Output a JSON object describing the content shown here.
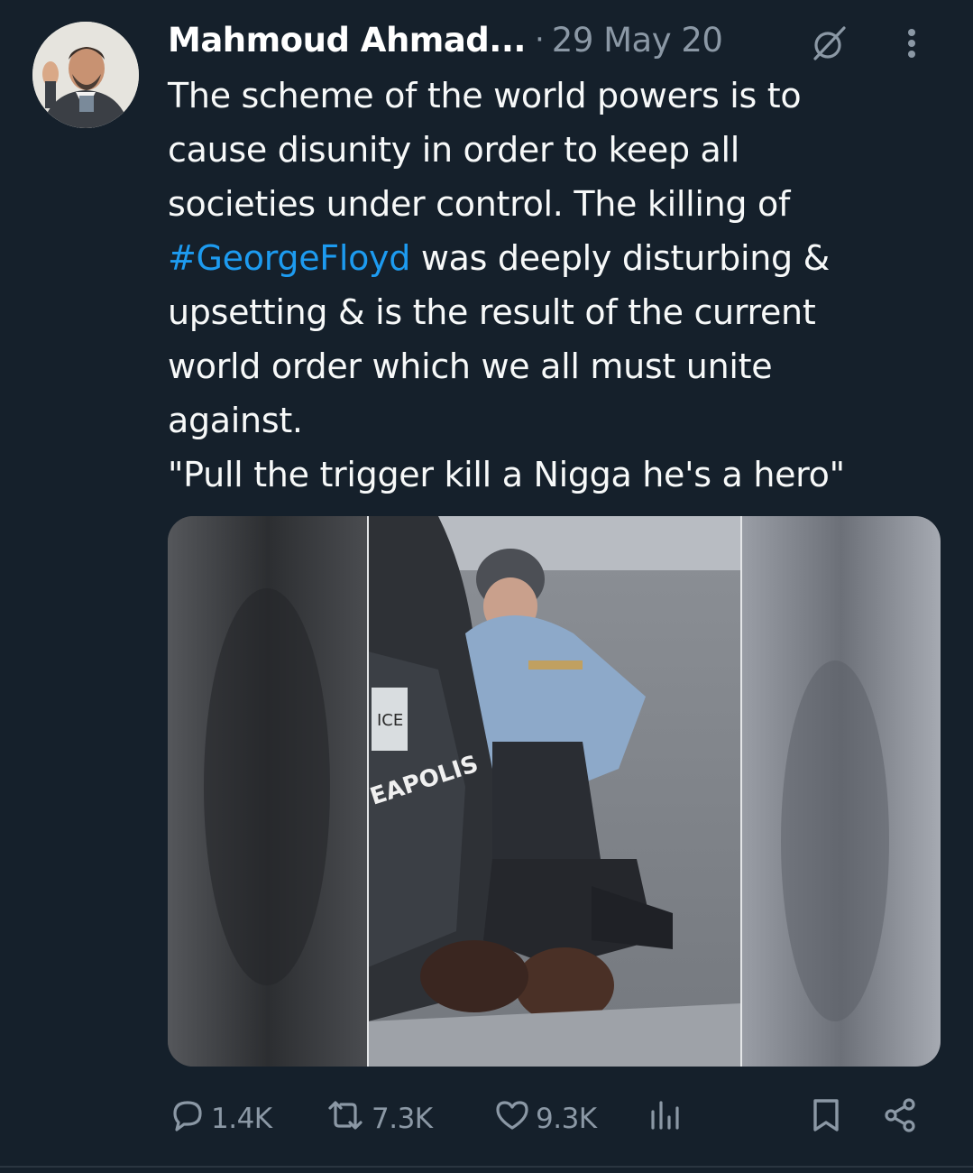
{
  "tweet": {
    "author_name": "Mahmoud Ahmad...",
    "separator": "·",
    "timestamp": "29 May 20",
    "text_lines": [
      "The scheme of the world powers is to",
      "cause disunity in order to keep all",
      "societies under control. The killing of",
      "",
      "upsetting & is the result of the current",
      "world order which we all must unite",
      "against.",
      "\"Pull the trigger kill a Nigga he's a hero\""
    ],
    "hashtag": "#GeorgeFloyd",
    "hashtag_line_rest": " was deeply disturbing &",
    "media_texts": [
      "ICE",
      "EAPOLIS"
    ]
  },
  "actions": {
    "reply": {
      "icon": "reply-icon",
      "count": "1.4K"
    },
    "retweet": {
      "icon": "retweet-icon",
      "count": "7.3K"
    },
    "like": {
      "icon": "heart-icon",
      "count": "9.3K"
    },
    "views": {
      "icon": "views-icon"
    },
    "bookmark": {
      "icon": "bookmark-icon"
    },
    "share": {
      "icon": "share-icon"
    }
  },
  "colors": {
    "background": "#15202b",
    "text": "#f7f9f9",
    "muted": "#8b98a5",
    "link": "#1d9bf0"
  }
}
